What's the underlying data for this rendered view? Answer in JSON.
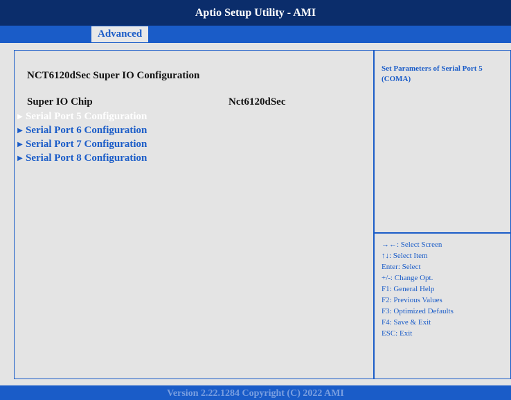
{
  "header": {
    "title": "Aptio Setup Utility - AMI"
  },
  "tabs": [
    {
      "label": "Advanced",
      "active": true
    }
  ],
  "left_panel": {
    "section_title": "NCT6120dSec Super IO Configuration",
    "super_io": {
      "label": "Super IO Chip",
      "value": "Nct6120dSec"
    },
    "menu_items": [
      {
        "label": "Serial Port 5 Configuration",
        "selected": true
      },
      {
        "label": "Serial Port 6 Configuration",
        "selected": false
      },
      {
        "label": "Serial Port 7 Configuration",
        "selected": false
      },
      {
        "label": "Serial Port 8 Configuration",
        "selected": false
      }
    ],
    "arrow_icon": "triangle-right-icon"
  },
  "help": {
    "text": "Set Parameters of Serial Port 5 (COMA)"
  },
  "keys": [
    "→←: Select Screen",
    "↑↓: Select Item",
    "Enter: Select",
    "+/-: Change Opt.",
    "F1: General Help",
    "F2: Previous Values",
    "F3: Optimized Defaults",
    "F4: Save & Exit",
    "ESC: Exit"
  ],
  "footer": {
    "text": "Version 2.22.1284 Copyright (C) 2022 AMI"
  },
  "colors": {
    "title_bg": "#0b2d6b",
    "accent": "#1a5cc8",
    "panel_bg": "#e4e4e4",
    "selected_text": "#ffffff"
  }
}
